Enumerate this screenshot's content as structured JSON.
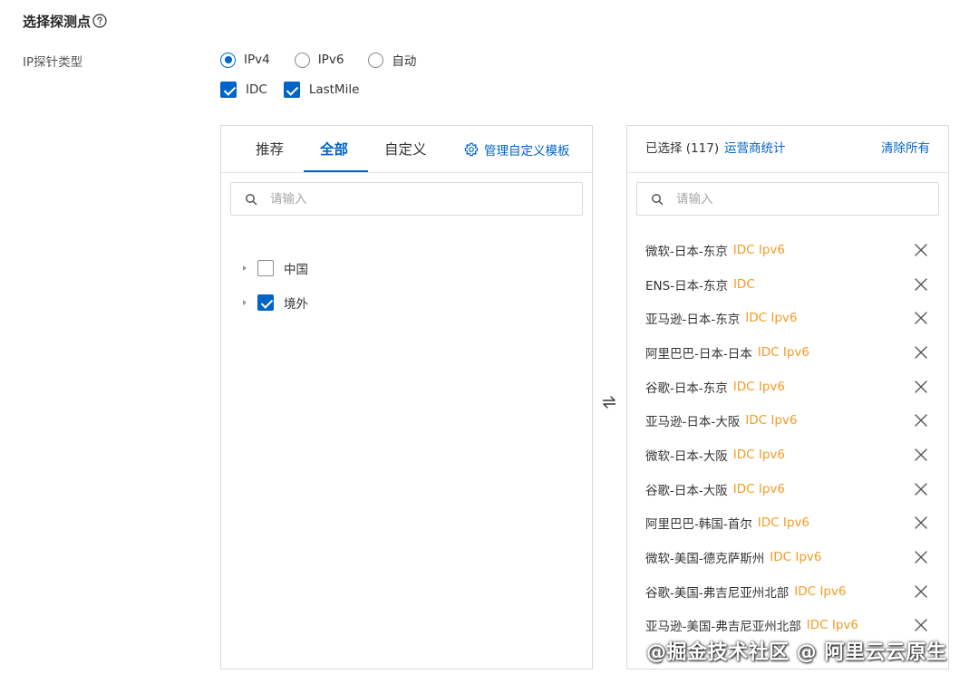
{
  "section": {
    "title": "选择探测点",
    "help_icon": "question-circle-icon"
  },
  "ip_type": {
    "label": "IP探针类型",
    "options": [
      {
        "label": "IPv4",
        "checked": true
      },
      {
        "label": "IPv6",
        "checked": false
      },
      {
        "label": "自动",
        "checked": false
      }
    ]
  },
  "network_type": {
    "options": [
      {
        "label": "IDC",
        "checked": true
      },
      {
        "label": "LastMile",
        "checked": true
      }
    ]
  },
  "left_panel": {
    "tabs": [
      {
        "label": "推荐",
        "active": false
      },
      {
        "label": "全部",
        "active": true
      },
      {
        "label": "自定义",
        "active": false
      }
    ],
    "manage_label": "管理自定义模板",
    "search_placeholder": "请输入",
    "tree": [
      {
        "label": "中国",
        "checked": false
      },
      {
        "label": "境外",
        "checked": true
      }
    ]
  },
  "transfer_icon": "swap-arrows-icon",
  "right_panel": {
    "selected_label": "已选择 (117)",
    "operator_stats_label": "运营商统计",
    "clear_all_label": "清除所有",
    "search_placeholder": "请输入",
    "items": [
      {
        "name": "微软-日本-东京",
        "tag": "IDC Ipv6"
      },
      {
        "name": "ENS-日本-东京",
        "tag": "IDC"
      },
      {
        "name": "亚马逊-日本-东京",
        "tag": "IDC Ipv6"
      },
      {
        "name": "阿里巴巴-日本-日本",
        "tag": "IDC Ipv6"
      },
      {
        "name": "谷歌-日本-东京",
        "tag": "IDC Ipv6"
      },
      {
        "name": "亚马逊-日本-大阪",
        "tag": "IDC Ipv6"
      },
      {
        "name": "微软-日本-大阪",
        "tag": "IDC Ipv6"
      },
      {
        "name": "谷歌-日本-大阪",
        "tag": "IDC Ipv6"
      },
      {
        "name": "阿里巴巴-韩国-首尔",
        "tag": "IDC Ipv6"
      },
      {
        "name": "微软-美国-德克萨斯州",
        "tag": "IDC Ipv6"
      },
      {
        "name": "谷歌-美国-弗吉尼亚州北部",
        "tag": "IDC Ipv6"
      },
      {
        "name": "亚马逊-美国-弗吉尼亚州北部",
        "tag": "IDC Ipv6"
      }
    ]
  },
  "colors": {
    "primary": "#0064c8",
    "tag": "#f59a23",
    "border": "#d9d9d9"
  },
  "watermark": "@掘金技术社区 @ 阿里云云原生"
}
